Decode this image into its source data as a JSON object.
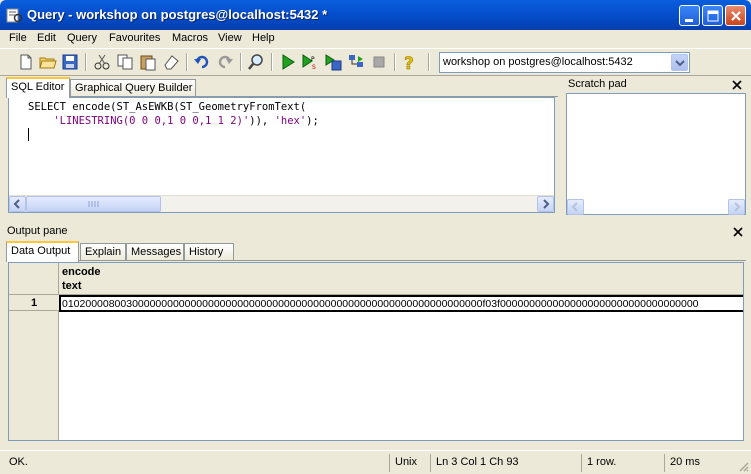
{
  "window": {
    "title": "Query - workshop on postgres@localhost:5432 *"
  },
  "menu": [
    "File",
    "Edit",
    "Query",
    "Favourites",
    "Macros",
    "View",
    "Help"
  ],
  "toolbar": {
    "connection": "workshop on postgres@localhost:5432"
  },
  "editor_tabs": [
    "SQL Editor",
    "Graphical Query Builder"
  ],
  "editor": {
    "line1": "SELECT encode(ST_AsEWKB(ST_GeometryFromText(",
    "line2_indent": "    ",
    "line2_str1": "'LINESTRING(0 0 0,1 0 0,1 1 2)'",
    "line2_mid": ")), ",
    "line2_str2": "'hex'",
    "line2_end": ");"
  },
  "scratch_pad": {
    "title": "Scratch pad"
  },
  "output": {
    "title": "Output pane",
    "tabs": [
      "Data Output",
      "Explain",
      "Messages",
      "History"
    ],
    "columns": [
      {
        "name": "encode",
        "type": "text"
      }
    ],
    "rows": [
      {
        "num": "1",
        "value": "010200008003000000000000000000000000000000000000000000000000000000000000f03f0000000000000000000000000000000000"
      }
    ]
  },
  "status": {
    "message": "OK.",
    "format": "Unix",
    "position": "Ln 3 Col 1 Ch 93",
    "rows": "1 row.",
    "time": "20 ms"
  },
  "colors": {
    "titlebar": "#0550cf",
    "string_literal": "#7f007f",
    "window_bg": "#ece9d8"
  }
}
